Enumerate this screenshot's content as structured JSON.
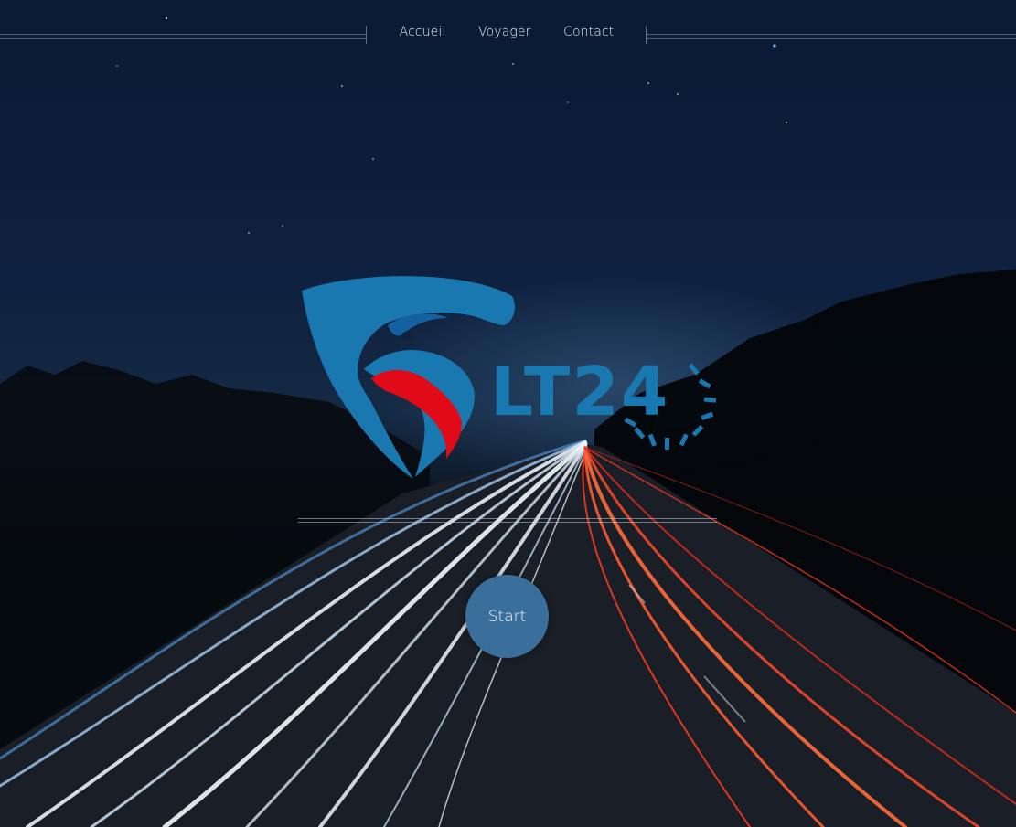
{
  "nav": {
    "links": [
      {
        "label": "Accueil"
      },
      {
        "label": "Voyager"
      },
      {
        "label": "Contact"
      }
    ]
  },
  "logo": {
    "text": "LT24",
    "icon": "eagle-shield-icon"
  },
  "hero": {
    "start_label": "Start"
  },
  "colors": {
    "brand_blue": "#1a78b0",
    "brand_red": "#e10a18",
    "button_bg": "#3a6f9c",
    "sky_top": "#0b1a33",
    "light_trail_blue": "#cfe2f5",
    "light_trail_red": "#ff4a2a"
  }
}
